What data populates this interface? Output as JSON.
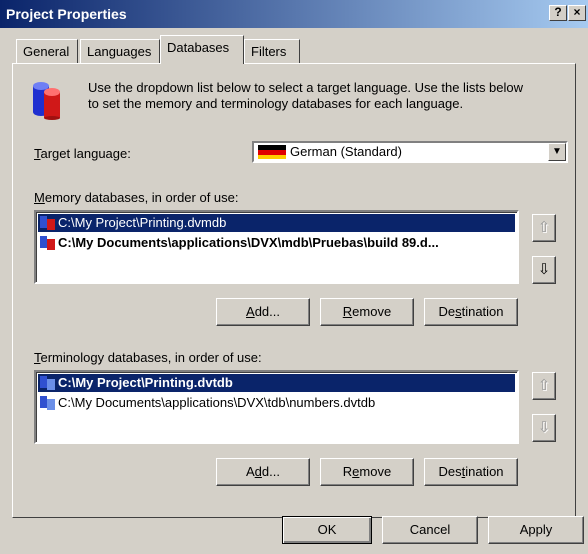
{
  "window": {
    "title": "Project Properties",
    "help_btn": "?",
    "close_btn": "×"
  },
  "tabs": [
    {
      "label": "General"
    },
    {
      "label": "Languages"
    },
    {
      "label": "Databases"
    },
    {
      "label": "Filters"
    }
  ],
  "intro": {
    "text_line1": "Use the dropdown list below to select a target language. Use the lists below",
    "text_line2": "to set the memory and terminology databases for each language."
  },
  "target_language": {
    "label_u": "T",
    "label_rest": "arget language:",
    "value": "German (Standard)"
  },
  "memory": {
    "label_u": "M",
    "label_rest": "emory databases, in order of use:",
    "items": [
      {
        "text": "C:\\My Project\\Printing.dvmdb"
      },
      {
        "text": "C:\\My Documents\\applications\\DVX\\mdb\\Pruebas\\build 89.d..."
      }
    ],
    "add_u": "A",
    "add_rest": "dd...",
    "remove_u": "R",
    "remove_rest": "emove",
    "dest_pre": "De",
    "dest_u": "s",
    "dest_rest": "tination"
  },
  "terminology": {
    "label_u": "T",
    "label_rest": "erminology databases, in order of use:",
    "items": [
      {
        "text": "C:\\My Project\\Printing.dvtdb"
      },
      {
        "text": "C:\\My Documents\\applications\\DVX\\tdb\\numbers.dvtdb"
      }
    ],
    "add_pre": "A",
    "add_u": "d",
    "add_rest": "d...",
    "remove_pre": "R",
    "remove_u": "e",
    "remove_rest": "move",
    "dest_pre": "Des",
    "dest_u": "t",
    "dest_rest": "ination"
  },
  "footer": {
    "ok": "OK",
    "cancel": "Cancel",
    "apply": "Apply"
  }
}
